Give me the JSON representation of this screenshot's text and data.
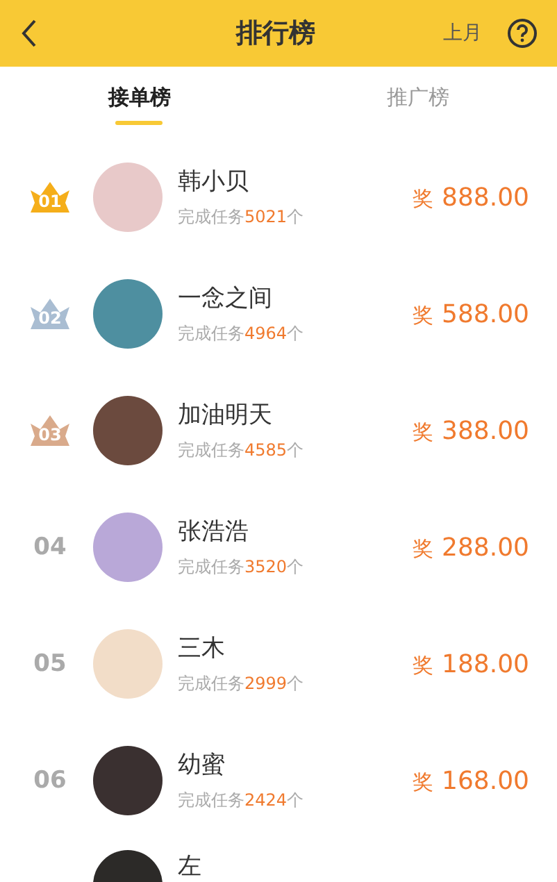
{
  "header": {
    "title": "排行榜",
    "period": "上月"
  },
  "tabs": [
    {
      "label": "接单榜",
      "selected": true
    },
    {
      "label": "推广榜",
      "selected": false
    }
  ],
  "rows": [
    {
      "rank": "01",
      "kind": "crown",
      "color": "#f5ae1a",
      "name": "韩小贝",
      "task_prefix": "完成任务",
      "count": "5021",
      "task_suffix": "个",
      "prize_label": "奖",
      "prize": "888.00"
    },
    {
      "rank": "02",
      "kind": "crown",
      "color": "#a9bdd2",
      "name": "一念之间",
      "task_prefix": "完成任务",
      "count": "4964",
      "task_suffix": "个",
      "prize_label": "奖",
      "prize": "588.00"
    },
    {
      "rank": "03",
      "kind": "crown",
      "color": "#d9aa8b",
      "name": "加油明天",
      "task_prefix": "完成任务",
      "count": "4585",
      "task_suffix": "个",
      "prize_label": "奖",
      "prize": "388.00"
    },
    {
      "rank": "04",
      "kind": "plain",
      "name": "张浩浩",
      "task_prefix": "完成任务",
      "count": "3520",
      "task_suffix": "个",
      "prize_label": "奖",
      "prize": "288.00"
    },
    {
      "rank": "05",
      "kind": "plain",
      "name": "三木",
      "task_prefix": "完成任务",
      "count": "2999",
      "task_suffix": "个",
      "prize_label": "奖",
      "prize": "188.00"
    },
    {
      "rank": "06",
      "kind": "plain",
      "name": "幼蜜",
      "task_prefix": "完成任务",
      "count": "2424",
      "task_suffix": "个",
      "prize_label": "奖",
      "prize": "168.00"
    }
  ],
  "partial_row": {
    "name": "左"
  }
}
